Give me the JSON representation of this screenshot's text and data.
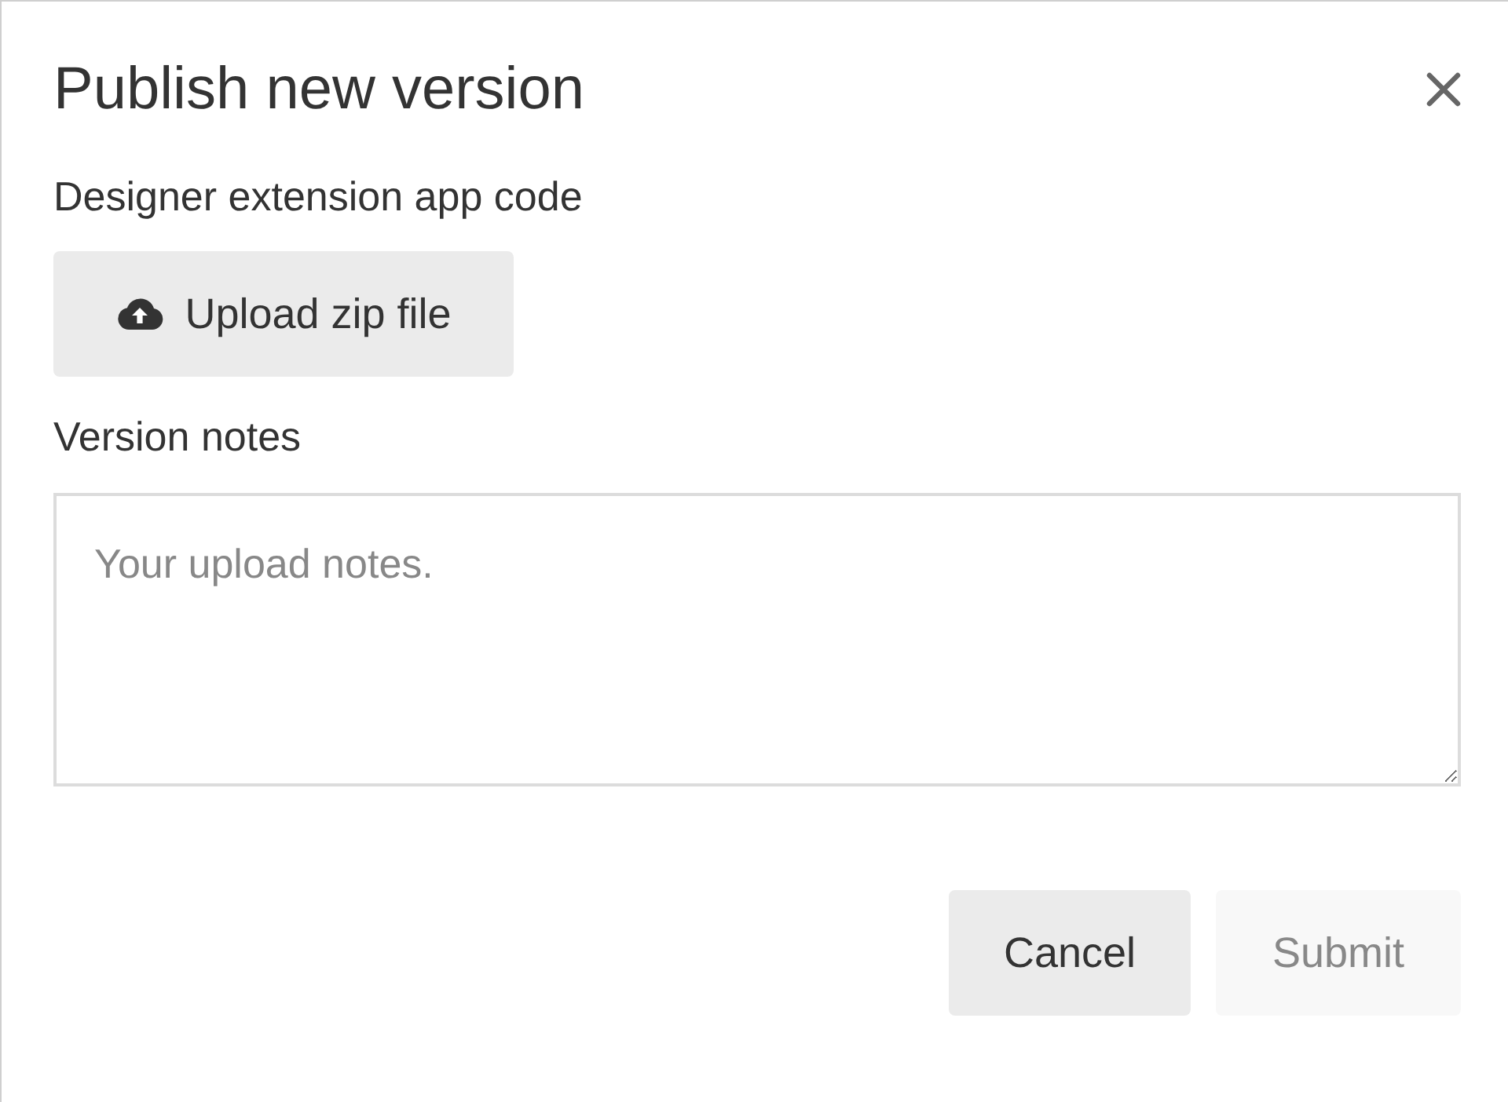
{
  "dialog": {
    "title": "Publish new version"
  },
  "code_field": {
    "label": "Designer extension app code",
    "upload_button": "Upload zip file"
  },
  "notes_field": {
    "label": "Version notes",
    "placeholder": "Your upload notes."
  },
  "buttons": [
    {
      "label": "Cancel",
      "disabled": false
    },
    {
      "label": "Submit",
      "disabled": true
    }
  ]
}
